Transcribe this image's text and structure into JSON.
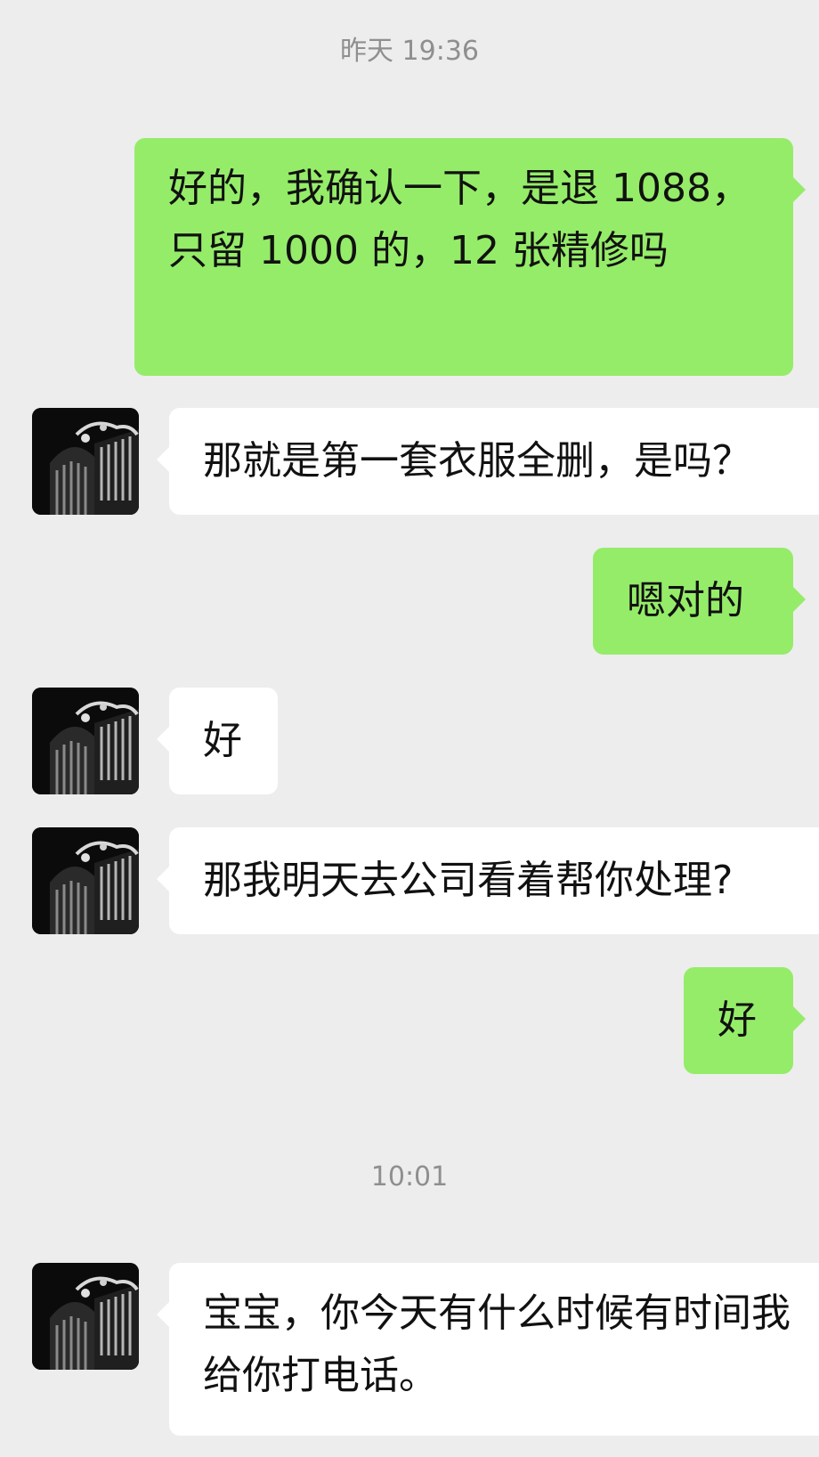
{
  "timestamps": [
    "昨天 19:36",
    "10:01"
  ],
  "messages": [
    {
      "sender": "me",
      "text": "好的，我确认一下，是退 1088，只留 1000 的，12 张精修吗"
    },
    {
      "sender": "contact",
      "text": "那就是第一套衣服全删，是吗？"
    },
    {
      "sender": "me",
      "text": "嗯对的"
    },
    {
      "sender": "contact",
      "text": "好"
    },
    {
      "sender": "contact",
      "text": "那我明天去公司看着帮你处理?"
    },
    {
      "sender": "me",
      "text": "好"
    },
    {
      "sender": "contact",
      "text": "宝宝，你今天有什么时候有时间我给你打电话。"
    }
  ],
  "colors": {
    "background": "#ededed",
    "my_bubble": "#95ec69",
    "contact_bubble": "#ffffff",
    "timestamp_text": "#8f8f8f"
  },
  "icons": {
    "contact_avatar": "dark-gate-photo-avatar"
  }
}
